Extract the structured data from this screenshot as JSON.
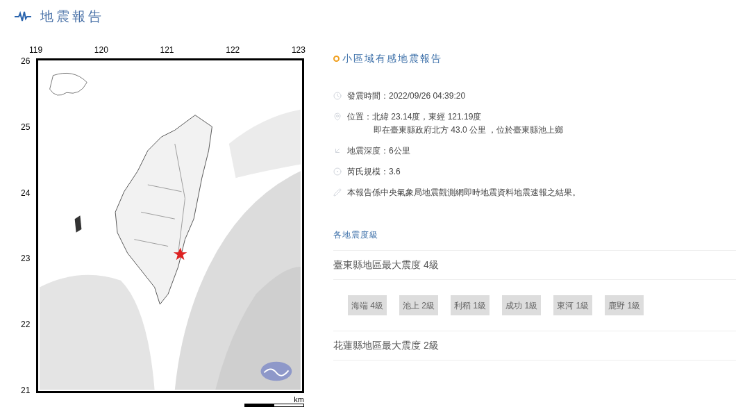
{
  "header": {
    "title": "地震報告"
  },
  "map": {
    "lon_labels": [
      "119",
      "120",
      "121",
      "122",
      "123"
    ],
    "lat_labels": [
      "26",
      "25",
      "24",
      "23",
      "22",
      "21"
    ],
    "scale_unit": "km"
  },
  "report": {
    "title": "小區域有感地震報告",
    "details": [
      {
        "kind": "time",
        "lines": [
          "發震時間：2022/09/26 04:39:20"
        ]
      },
      {
        "kind": "location",
        "lines": [
          "位置：北緯 23.14度，東經 121.19度",
          "即在臺東縣政府北方 43.0 公里 ，位於臺東縣池上鄉"
        ]
      },
      {
        "kind": "depth",
        "lines": [
          "地震深度：6公里"
        ]
      },
      {
        "kind": "magnitude",
        "lines": [
          "芮氏規模：3.6"
        ]
      },
      {
        "kind": "note",
        "lines": [
          "本報告係中央氣象局地震觀測網即時地震資料地震速報之結果。"
        ]
      }
    ]
  },
  "intensity": {
    "heading": "各地震度級",
    "regions": [
      {
        "title": "臺東縣地區最大震度 4級",
        "stations": [
          "海端 4級",
          "池上 2級",
          "利稻 1級",
          "成功 1級",
          "東河 1級",
          "鹿野 1級"
        ]
      },
      {
        "title": "花蓮縣地區最大震度 2級"
      }
    ]
  }
}
